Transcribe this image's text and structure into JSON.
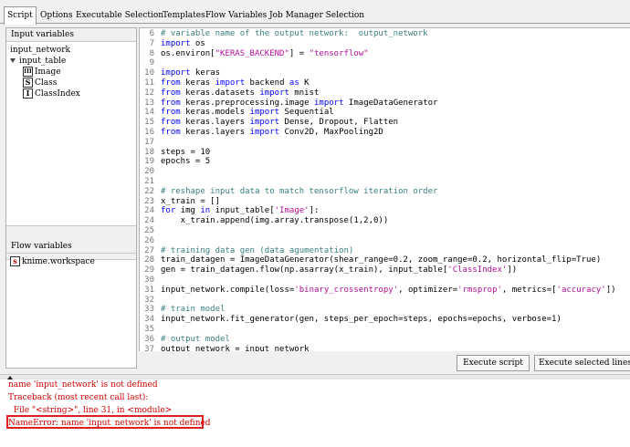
{
  "tabs": [
    "Script",
    "Options",
    "Executable Selection",
    "Templates",
    "Flow Variables",
    "Job Manager Selection"
  ],
  "input_variables": {
    "header": "Input variables",
    "items": [
      {
        "label": "input_network"
      },
      {
        "label": "input_table"
      },
      {
        "label": "Image",
        "icon": "III"
      },
      {
        "label": "Class",
        "icon": "S"
      },
      {
        "label": "ClassIndex",
        "icon": "I"
      }
    ]
  },
  "flow_variables": {
    "header": "Flow variables",
    "items": [
      {
        "label": "knime.workspace",
        "icon": "s"
      }
    ]
  },
  "editor": {
    "lines": [
      {
        "n": "6",
        "code": "# variable name of the output network:  output_network"
      },
      {
        "n": "7",
        "code": "import os"
      },
      {
        "n": "8",
        "code": "os.environ[\"KERAS_BACKEND\"] = \"tensorflow\""
      },
      {
        "n": "9",
        "code": ""
      },
      {
        "n": "10",
        "code": "import keras"
      },
      {
        "n": "11",
        "code": "from keras import backend as K"
      },
      {
        "n": "12",
        "code": "from keras.datasets import mnist"
      },
      {
        "n": "13",
        "code": "from keras.preprocessing.image import ImageDataGenerator"
      },
      {
        "n": "14",
        "code": "from keras.models import Sequential"
      },
      {
        "n": "15",
        "code": "from keras.layers import Dense, Dropout, Flatten"
      },
      {
        "n": "16",
        "code": "from keras.layers import Conv2D, MaxPooling2D"
      },
      {
        "n": "17",
        "code": ""
      },
      {
        "n": "18",
        "code": "steps = 10"
      },
      {
        "n": "19",
        "code": "epochs = 5"
      },
      {
        "n": "20",
        "code": ""
      },
      {
        "n": "21",
        "code": ""
      },
      {
        "n": "22",
        "code": "# reshape input data to match tensorflow iteration order"
      },
      {
        "n": "23",
        "code": "x_train = []"
      },
      {
        "n": "24",
        "code": "for img in input_table['Image']:"
      },
      {
        "n": "24",
        "code": "    x_train.append(img.array.transpose(1,2,0))"
      },
      {
        "n": "25",
        "code": ""
      },
      {
        "n": "26",
        "code": ""
      },
      {
        "n": "27",
        "code": "# training data gen (data agumentation)"
      },
      {
        "n": "28",
        "code": "train_datagen = ImageDataGenerator(shear_range=0.2, zoom_range=0.2, horizontal_flip=True)"
      },
      {
        "n": "29",
        "code": "gen = train_datagen.flow(np.asarray(x_train), input_table['ClassIndex'])"
      },
      {
        "n": "30",
        "code": ""
      },
      {
        "n": "31",
        "code": "input_network.compile(loss='binary_crossentropy', optimizer='rmsprop', metrics=['accuracy'])"
      },
      {
        "n": "32",
        "code": ""
      },
      {
        "n": "33",
        "code": "# train model"
      },
      {
        "n": "34",
        "code": "input_network.fit_generator(gen, steps_per_epoch=steps, epochs=epochs, verbose=1)"
      },
      {
        "n": "35",
        "code": ""
      },
      {
        "n": "36",
        "code": "# output model"
      },
      {
        "n": "37",
        "code": "output_network = input_network"
      }
    ]
  },
  "buttons": {
    "execute_script": "Execute script",
    "execute_selected": "Execute selected lines"
  },
  "console": {
    "lines": [
      "name 'input_network' is not defined",
      "Traceback (most recent call last):",
      "  File \"<string>\", line 31, in <module>",
      "NameError: name 'input_network' is not defined"
    ],
    "highlight_color": "#e02020",
    "text_color": "#d00000"
  }
}
